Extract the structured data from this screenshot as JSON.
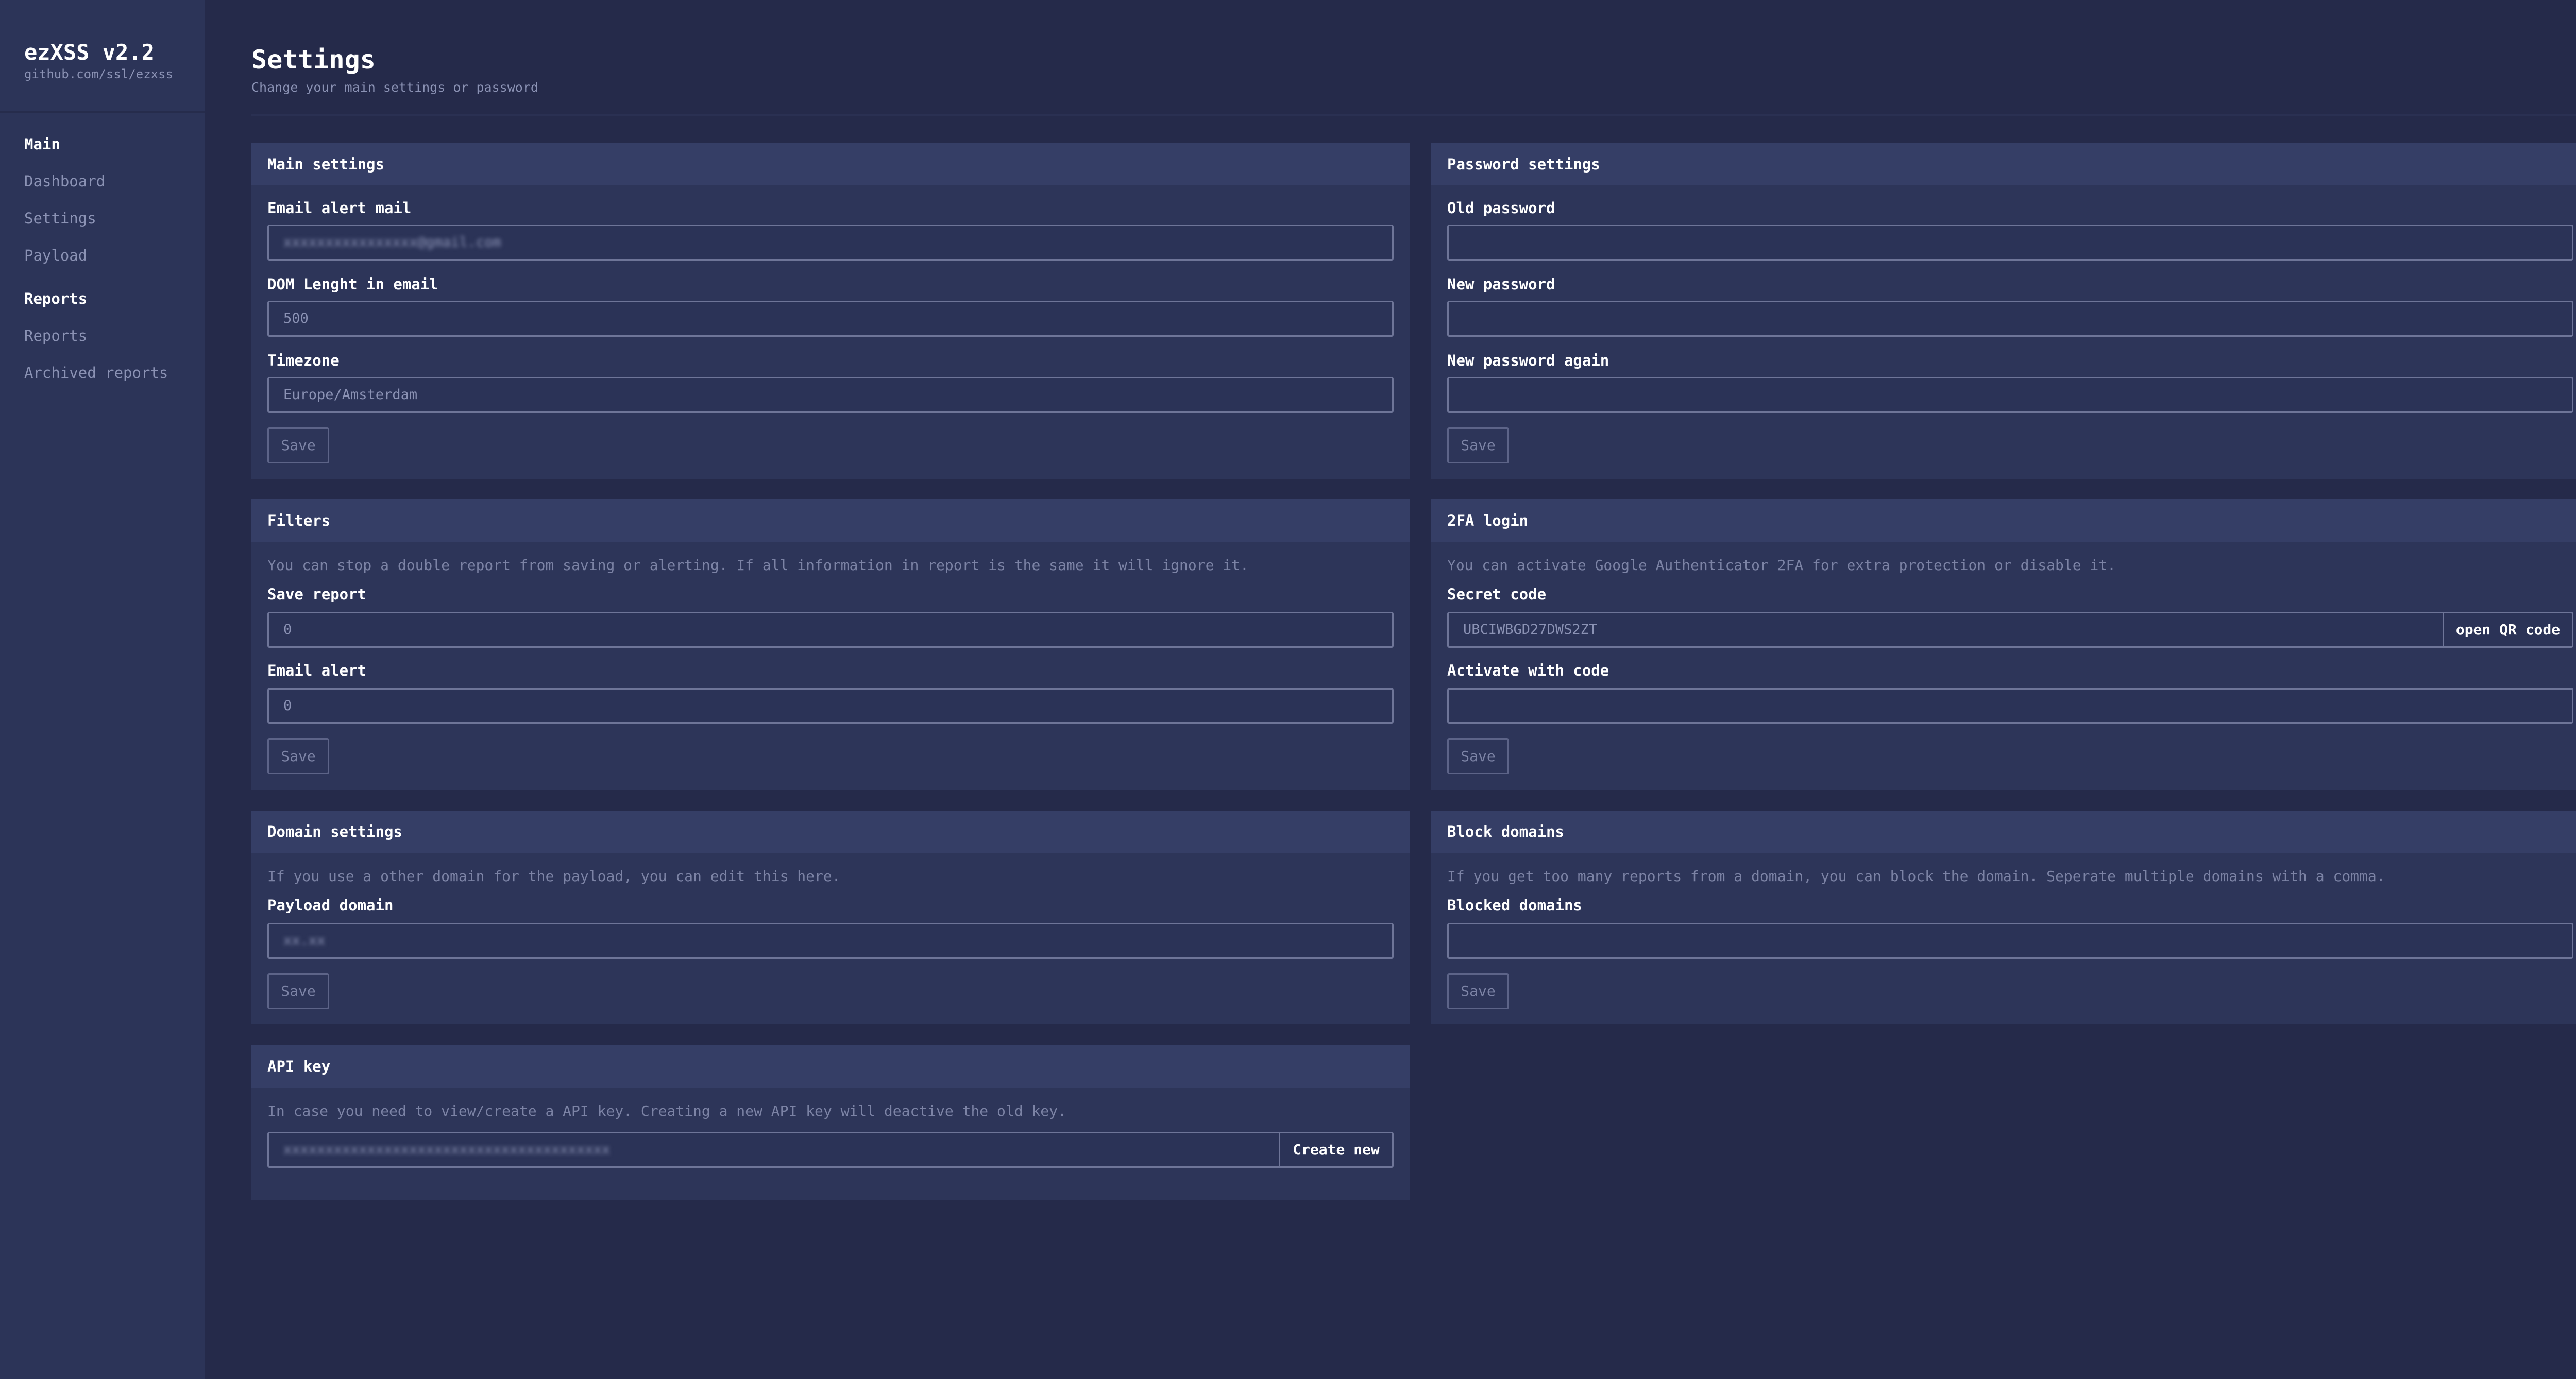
{
  "sidebar": {
    "brand_title": "ezXSS v2.2",
    "brand_sub": "github.com/ssl/ezxss",
    "sections": [
      {
        "heading": "Main",
        "items": [
          "Dashboard",
          "Settings",
          "Payload"
        ]
      },
      {
        "heading": "Reports",
        "items": [
          "Reports",
          "Archived reports"
        ]
      }
    ]
  },
  "page": {
    "title": "Settings",
    "subtitle": "Change your main settings or password"
  },
  "main_settings": {
    "title": "Main settings",
    "email_label": "Email alert mail",
    "email_value": "xxxxxxxxxxxxxxxx@gmail.com",
    "dom_label": "DOM Lenght in email",
    "dom_value": "500",
    "tz_label": "Timezone",
    "tz_value": "Europe/Amsterdam",
    "save": "Save"
  },
  "password_settings": {
    "title": "Password settings",
    "old_label": "Old password",
    "new_label": "New password",
    "again_label": "New password again",
    "save": "Save"
  },
  "filters": {
    "title": "Filters",
    "desc": "You can stop a double report from saving or alerting. If all information in report is the same it will ignore it.",
    "save_report_label": "Save report",
    "save_report_value": "0",
    "email_alert_label": "Email alert",
    "email_alert_value": "0",
    "save": "Save"
  },
  "twofa": {
    "title": "2FA login",
    "desc": "You can activate Google Authenticator 2FA for extra protection or disable it.",
    "secret_label": "Secret code",
    "secret_value": "UBCIWBGD27DWS2ZT",
    "qr_button": "open QR code",
    "activate_label": "Activate with code",
    "save": "Save"
  },
  "domain_settings": {
    "title": "Domain settings",
    "desc": "If you use a other domain for the payload, you can edit this here.",
    "payload_label": "Payload domain",
    "payload_value": "xx.xx",
    "save": "Save"
  },
  "block_domains": {
    "title": "Block domains",
    "desc": "If you get too many reports from a domain, you can block the domain. Seperate multiple domains with a comma.",
    "blocked_label": "Blocked domains",
    "save": "Save"
  },
  "api_key": {
    "title": "API key",
    "desc": "In case you need to view/create a API key. Creating a new API key will deactive the old key.",
    "key_value": "xxxxxxxxxxxxxxxxxxxxxxxxxxxxxxxxxxxxxxx",
    "create_button": "Create new"
  }
}
